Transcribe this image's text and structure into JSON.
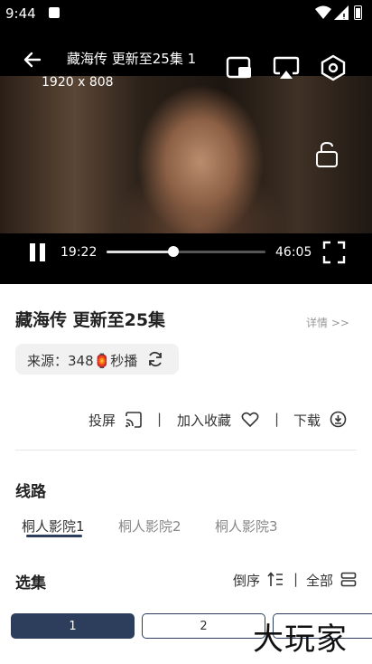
{
  "status_bar": {
    "time": "9:44"
  },
  "player": {
    "title": "藏海传 更新至25集 1",
    "resolution": "1920 x 808",
    "current_time": "19:22",
    "duration": "46:05",
    "progress": 0.42
  },
  "show": {
    "title": "藏海传 更新至25集",
    "detail_link": "详情 >>",
    "source_label": "来源：348🏮秒播"
  },
  "actions": {
    "cast": "投屏",
    "favorite": "加入收藏",
    "download": "下载",
    "sep1": "|",
    "sep2": "|"
  },
  "lines": {
    "title": "线路",
    "tabs": [
      "桐人影院1",
      "桐人影院2",
      "桐人影院3"
    ]
  },
  "episodes": {
    "title": "选集",
    "sort_label": "倒序",
    "sep": "|",
    "all_label": "全部",
    "items": [
      "1",
      "2"
    ]
  },
  "watermark": "大玩家",
  "colors": {
    "accent": "#2c3e5c",
    "tab_underline": "#2c3e5c"
  }
}
